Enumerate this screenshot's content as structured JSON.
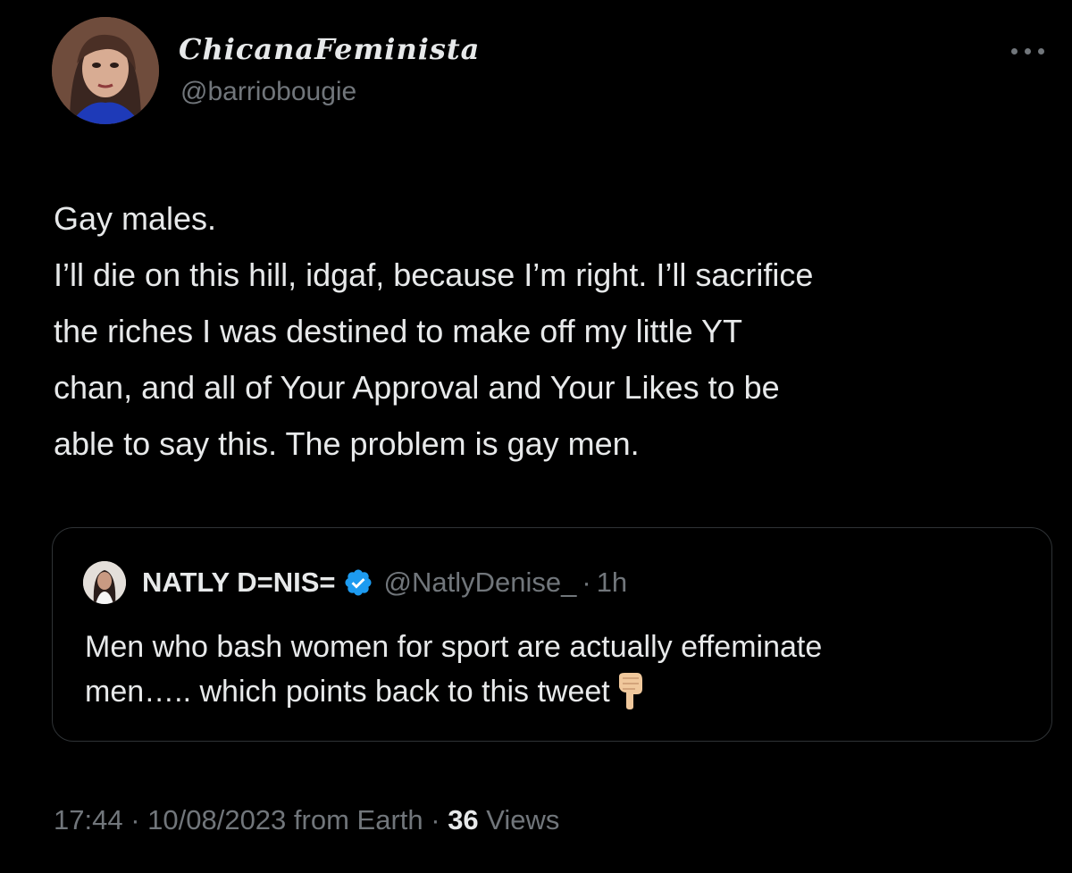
{
  "author": {
    "display_name": "ChicanaFeminista",
    "handle": "@barriobougie",
    "avatar_icon": "profile-photo"
  },
  "more_icon": "more-horizontal-icon",
  "tweet": {
    "lines": [
      "Gay males.",
      "I’ll die on this hill, idgaf, because I’m right. I’ll sacrifice",
      "the riches I was destined to make off my little YT",
      "chan, and all of Your Approval and Your Likes to be",
      "able to say this. The problem is gay men."
    ]
  },
  "quoted_tweet": {
    "display_name": "NATLY D=NIS=",
    "verified_icon": "verified-badge-icon",
    "handle": "@NatlyDenise_",
    "separator": "·",
    "time": "1h",
    "lines": [
      "Men who bash women for sport are actually effeminate",
      "men….. which points back to this tweet"
    ],
    "emoji": "backhand-index-pointing-down-icon"
  },
  "meta": {
    "time": "17:44",
    "sep1": " · ",
    "date": "10/08/2023",
    "source": " from Earth",
    "sep2": " · ",
    "views_count": "36",
    "views_label": " Views"
  },
  "colors": {
    "background": "#000000",
    "text_primary": "#e7e9ea",
    "text_secondary": "#71767b",
    "border": "#2f3336",
    "verified": "#1d9bf0"
  }
}
